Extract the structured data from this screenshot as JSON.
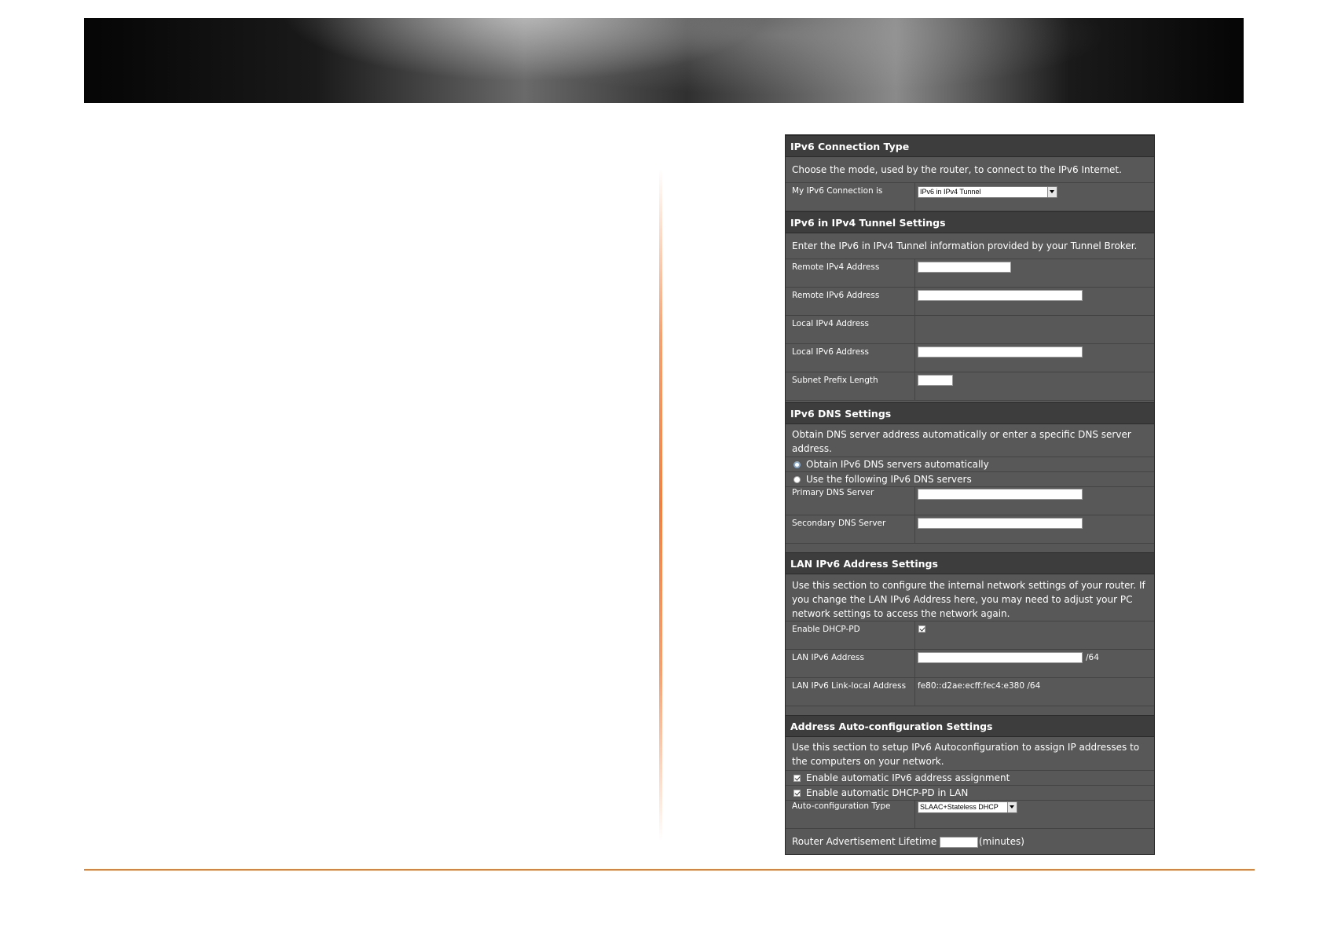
{
  "sections": {
    "connection_type": {
      "title": "IPv6 Connection Type",
      "description": "Choose the mode, used by the router, to connect to the IPv6 Internet.",
      "label": "My IPv6 Connection is",
      "selected": "IPv6 in IPv4 Tunnel"
    },
    "tunnel": {
      "title": "IPv6 in IPv4 Tunnel Settings",
      "description": "Enter the IPv6 in IPv4 Tunnel information provided by your Tunnel Broker.",
      "remote_ipv4_label": "Remote IPv4 Address",
      "remote_ipv4_value": "",
      "remote_ipv6_label": "Remote IPv6 Address",
      "remote_ipv6_value": "",
      "local_ipv4_label": "Local IPv4 Address",
      "local_ipv6_label": "Local IPv6 Address",
      "local_ipv6_value": "",
      "subnet_prefix_label": "Subnet Prefix Length",
      "subnet_prefix_value": ""
    },
    "dns": {
      "title": "IPv6 DNS Settings",
      "description_line1": "Obtain DNS server address automatically or enter a specific DNS server",
      "description_line2": "address.",
      "option_auto": "Obtain IPv6 DNS servers automatically",
      "option_manual": "Use the following IPv6 DNS servers",
      "primary_label": "Primary DNS Server",
      "primary_value": "",
      "secondary_label": "Secondary DNS Server",
      "secondary_value": ""
    },
    "lan": {
      "title": "LAN IPv6 Address Settings",
      "description_line1": "Use this section to configure the internal network settings of your router. If",
      "description_line2": "you change the LAN IPv6 Address here, you may need to adjust your PC",
      "description_line3": "network settings to access the network again.",
      "dhcp_pd_label": "Enable DHCP-PD",
      "lan_address_label": "LAN IPv6 Address",
      "lan_address_value": "",
      "lan_address_suffix": "/64",
      "link_local_label": "LAN IPv6 Link-local Address",
      "link_local_value": "fe80::d2ae:ecff:fec4:e380 /64"
    },
    "autoconfig": {
      "title": "Address Auto-configuration Settings",
      "description_line1": "Use this section to setup IPv6 Autoconfiguration to assign IP addresses to",
      "description_line2": "the computers on your network.",
      "option_auto_assign": "Enable automatic IPv6 address assignment",
      "option_dhcp_pd": "Enable automatic DHCP-PD in LAN",
      "type_label": "Auto-configuration Type",
      "type_selected": "SLAAC+Stateless DHCP",
      "lifetime_label": "Router Advertisement Lifetime",
      "lifetime_value": "",
      "lifetime_unit": "(minutes)"
    }
  }
}
